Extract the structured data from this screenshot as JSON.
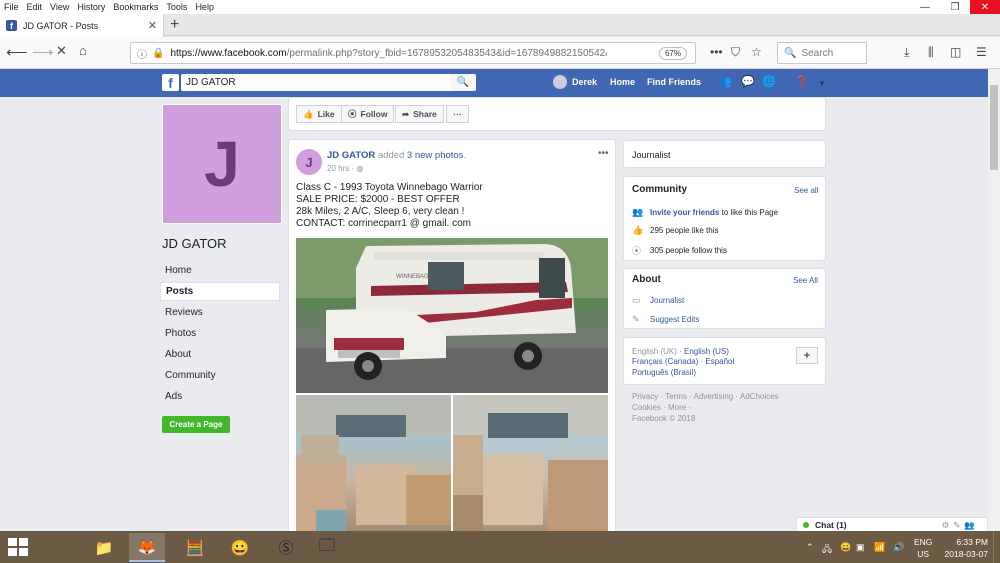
{
  "browser": {
    "menu": [
      "File",
      "Edit",
      "View",
      "History",
      "Bookmarks",
      "Tools",
      "Help"
    ],
    "tab_title": "JD GATOR - Posts",
    "url_prefix": "https://www.facebook.com",
    "url_rest": "/permalink.php?story_fbid=1678953205483543&id=1678949882150542&",
    "zoom": "67%",
    "search_placeholder": "Search"
  },
  "fb": {
    "search_value": "JD GATOR",
    "user_name": "Derek",
    "nav_home": "Home",
    "nav_find_friends": "Find Friends"
  },
  "page": {
    "initial": "J",
    "name": "JD GATOR",
    "nav": [
      "Home",
      "Posts",
      "Reviews",
      "Photos",
      "About",
      "Community",
      "Ads"
    ],
    "create_page": "Create a Page"
  },
  "actions": {
    "like": "Like",
    "follow": "Follow",
    "share": "Share",
    "more": "···"
  },
  "post": {
    "author": "JD GATOR",
    "action_word": "added",
    "action_link": "3 new photos",
    "action_end": ".",
    "time": "20 hrs · ◍",
    "lines": [
      "Class C - 1993 Toyota Winnebago Warrior",
      "SALE PRICE: $2000 - BEST OFFER",
      "28k Miles, 2 A/C, Sleep 6, very clean !",
      "CONTACT: corrinecparr1 @ gmail. com"
    ],
    "photo_text": "WINNEBAGO"
  },
  "right": {
    "category": "Journalist",
    "community_title": "Community",
    "see_all": "See all",
    "invite_link": "Invite your friends",
    "invite_rest": " to like this Page",
    "likes": "295 people like this",
    "follows": "305 people follow this",
    "about_title": "About",
    "see_all_about": "See All",
    "about_category": "Journalist",
    "suggest_edits": "Suggest Edits",
    "languages_line1_plain": "English (UK) · ",
    "languages_line1_link": "English (US)",
    "languages_line2": "Français (Canada) · Español",
    "languages_line3": "Português (Brasil)",
    "footer_line1": "Privacy · Terms · Advertising · AdChoices",
    "footer_line2": "Cookies · More ·",
    "footer_line3": "Facebook © 2018"
  },
  "chat": {
    "label": "Chat (1)"
  },
  "taskbar": {
    "lang1": "ENG",
    "lang2": "US",
    "time": "6:33 PM",
    "date": "2018-03-07"
  },
  "colors": {
    "fb_blue": "#4267b2",
    "link": "#365899",
    "green": "#42b72a",
    "avatar": "#d19fdd"
  }
}
